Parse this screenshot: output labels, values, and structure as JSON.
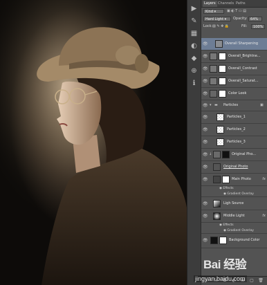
{
  "panel": {
    "tabs": [
      "Layers",
      "Channels",
      "Paths"
    ],
    "active_tab": "Layers",
    "filter_kind": "Kind",
    "blend_mode": "Hard Light",
    "opacity_label": "Opacity:",
    "opacity_value": "64%",
    "lock_label": "Lock:",
    "fill_label": "Fill:",
    "fill_value": "100%",
    "layers": [
      {
        "name": "Overall Sharpening",
        "selected": true
      },
      {
        "name": "Overall_Brightne..."
      },
      {
        "name": "Overall_Contrast"
      },
      {
        "name": "Overall_Saturat..."
      },
      {
        "name": "Color Look"
      },
      {
        "name": "Particles"
      },
      {
        "name": "Particles_1"
      },
      {
        "name": "Particles_2"
      },
      {
        "name": "Particles_3"
      },
      {
        "name": "Original Pho..."
      },
      {
        "name": "Original Photo"
      },
      {
        "name": "Main Photo",
        "fx": "fx",
        "effects": "Effects",
        "effect_item": "Gradient Overlay"
      },
      {
        "name": "Ligh Source"
      },
      {
        "name": "Middle Light",
        "fx": "fx",
        "effects": "Effects",
        "effect_item": "Gradient Overlay"
      },
      {
        "name": "Background Color"
      }
    ]
  },
  "watermark": {
    "logo": "Bai 经验",
    "url": "jingyan.baidu.com"
  },
  "colors": {
    "panel_bg": "#535353",
    "selected_row": "#6d7d95",
    "photo_tone": "#3a2f25"
  },
  "icons": [
    "eye-icon",
    "folder-icon",
    "lock-icon",
    "link-icon",
    "new-layer-icon",
    "trash-icon",
    "fx-icon",
    "mask-icon",
    "adjustment-icon"
  ]
}
